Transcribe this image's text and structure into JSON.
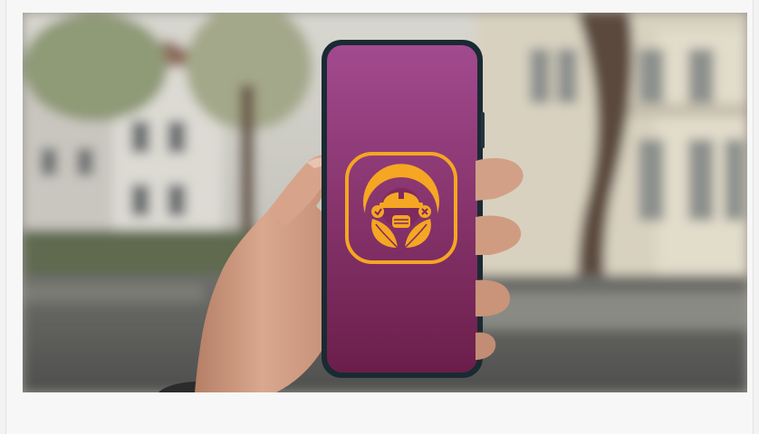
{
  "photo": {
    "subject": "hand-holding-smartphone",
    "app_icon": "safety-helmet-mask-leaf-icon",
    "colors": {
      "screen_top": "#a24a8f",
      "screen_bottom": "#6b1e4a",
      "icon_accent": "#f5a623",
      "phone_body": "#1a2a33"
    }
  }
}
